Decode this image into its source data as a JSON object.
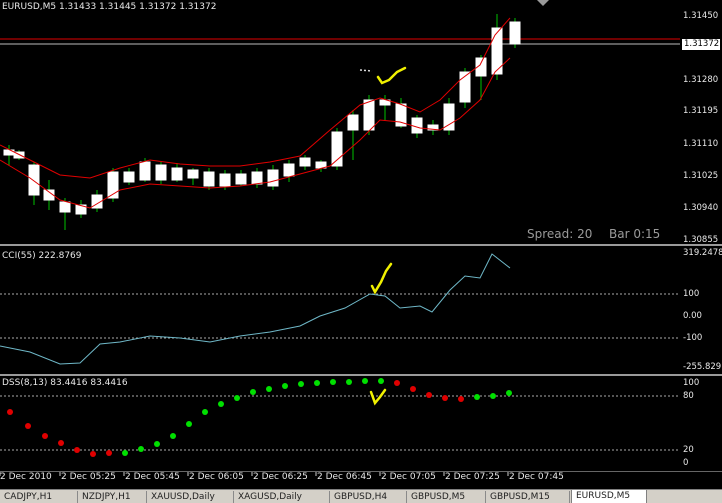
{
  "main_chart": {
    "symbol_header": "EURUSD,M5  1.31433 1.31445 1.31372 1.31372",
    "spread_label": "Spread: 20",
    "bar_label": "Bar  0:15",
    "price_ticks": [
      "1.31450",
      "1.31280",
      "1.31195",
      "1.31110",
      "1.31025",
      "1.30940",
      "1.30855"
    ],
    "current_price": "1.31372",
    "colors": {
      "bull_candle": "#ffffff",
      "bear_candle": "#ffffff",
      "wick": "#00c000",
      "band": "#e00000",
      "price_line": "#e00000"
    }
  },
  "cci_pane": {
    "header": "CCI(55) 222.8769",
    "ticks": [
      "319.2478",
      "100",
      "0.00",
      "-100",
      "-255.829"
    ],
    "line_color": "#6fb8c8"
  },
  "dss_pane": {
    "header": "DSS(8,13) 83.4416 83.4416",
    "ticks": [
      "100",
      "80",
      "20",
      "0"
    ],
    "colors": {
      "up": "#00e000",
      "down": "#e00000"
    }
  },
  "time_axis": [
    "2 Dec 2010",
    "2 Dec 05:25",
    "2 Dec 05:45",
    "2 Dec 06:05",
    "2 Dec 06:25",
    "2 Dec 06:45",
    "2 Dec 07:05",
    "2 Dec 07:25",
    "2 Dec 07:45"
  ],
  "chart_tabs": [
    {
      "label": "CADJPY,H1",
      "active": false
    },
    {
      "label": "NZDJPY,H1",
      "active": false
    },
    {
      "label": "XAUUSD,Daily",
      "active": false
    },
    {
      "label": "XAGUSD,Daily",
      "active": false
    },
    {
      "label": "GBPUSD,H4",
      "active": false
    },
    {
      "label": "GBPUSD,M5",
      "active": false
    },
    {
      "label": "GBPUSD,M15",
      "active": false
    },
    {
      "label": "EURUSD,M5",
      "active": true
    }
  ],
  "annotation_color": "#f0f000"
}
